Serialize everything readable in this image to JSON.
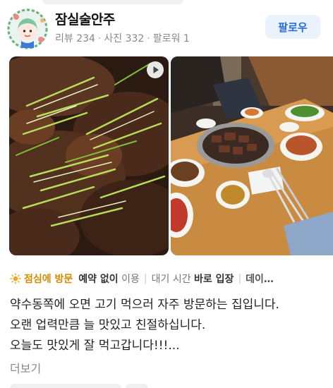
{
  "profile": {
    "name": "잠실술안주",
    "reviews": "리뷰 234",
    "photos": "사진 332",
    "followers": "팔로워 1",
    "follow_label": "팔로우"
  },
  "tags": {
    "visit_time": "점심에 방문",
    "reservation_strong": "예약 없이",
    "reservation_rest": " 이용",
    "wait_plain": "대기 시간 ",
    "wait_strong": "바로 입장",
    "more": "데이…"
  },
  "review": {
    "lines": [
      "약수동쪽에 오면 고기 먹으러 자주 방문하는 집입니다.",
      "오랜 업력만큼 늘 맛있고 친절하십니다.",
      "오늘도 맛있게 잘 먹고갑니다!!!..."
    ],
    "more_label": "더보기"
  },
  "colors": {
    "accent_blue": "#2a6fd6",
    "tag_highlight": "#d58a00"
  },
  "icons": {
    "time_icon": "sun-icon",
    "video_icon": "play-icon"
  }
}
